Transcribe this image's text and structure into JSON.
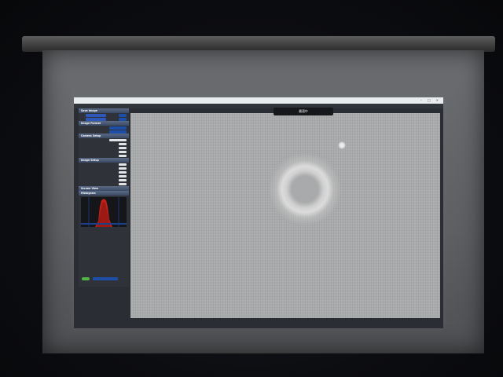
{
  "window": {
    "title": "",
    "tooltip": "最適中"
  },
  "menu": [],
  "sidebar": {
    "sections": [
      "Save Image",
      "Image Format",
      "Camera Setup",
      "Image Setup",
      "Screen View",
      "Histogram"
    ]
  },
  "status": {
    "left": "",
    "right": ""
  },
  "colors": {
    "panel_header": "#3c4a63",
    "accent_blue": "#1d4fa8",
    "auto_green": "#52b546",
    "histogram_fill": "#c0221b"
  }
}
